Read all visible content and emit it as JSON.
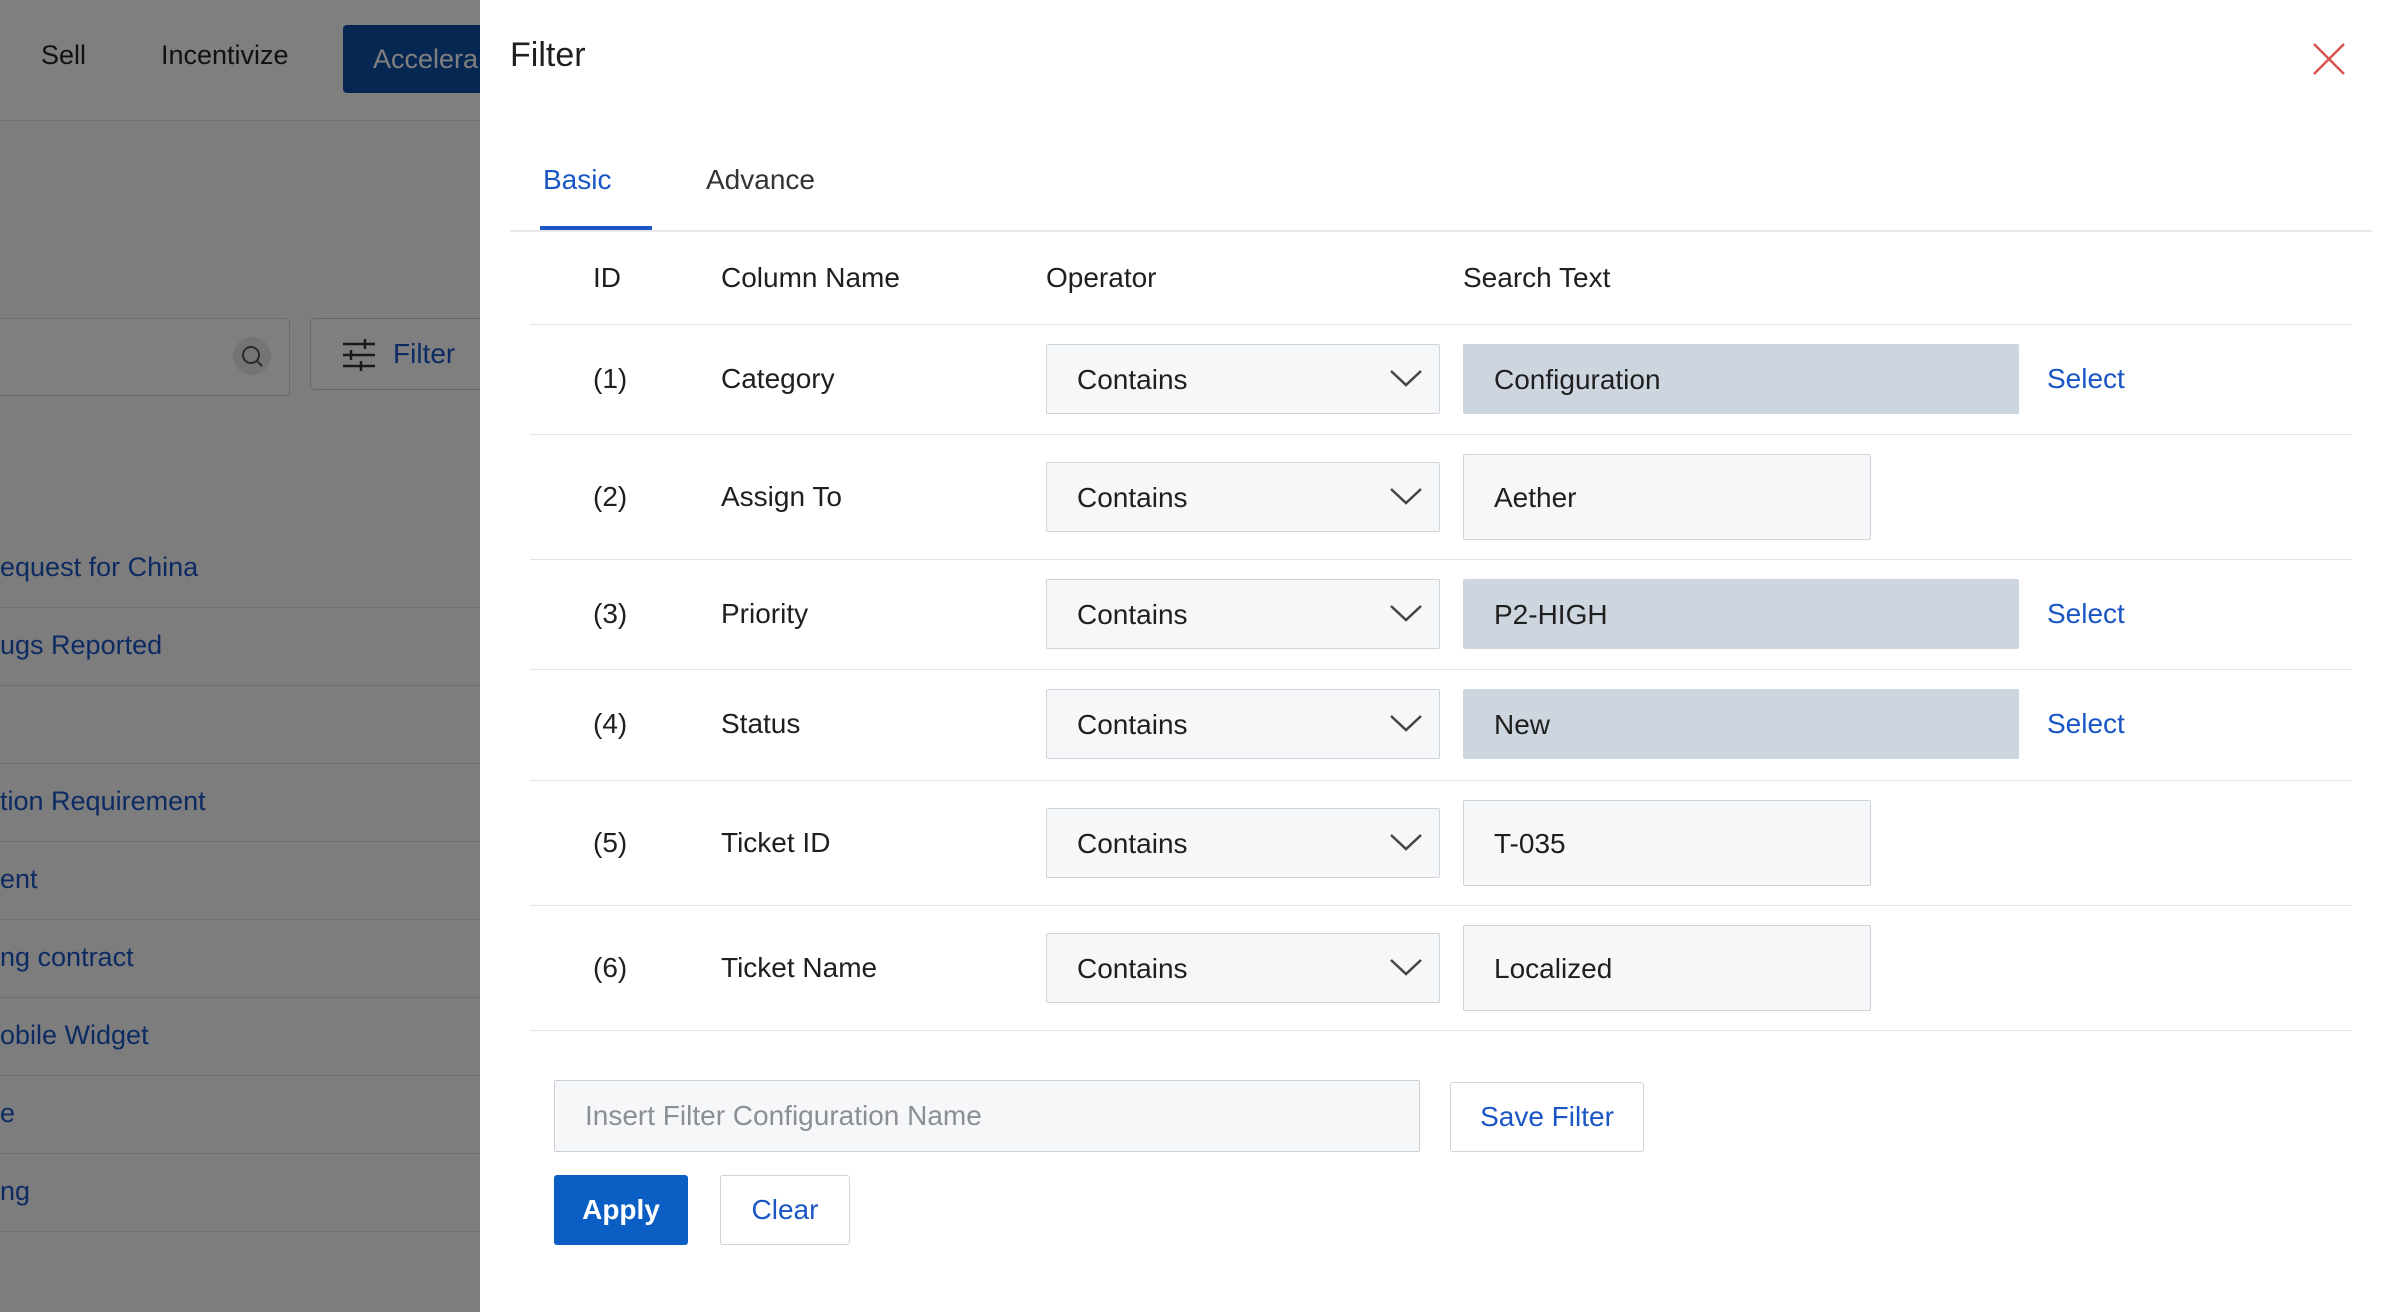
{
  "background": {
    "nav": [
      "Sell",
      "Incentivize"
    ],
    "nav_active": "Accelera",
    "filter_button": "Filter",
    "list_items": [
      "equest for China",
      "ugs Reported",
      "",
      "tion Requirement",
      "ent",
      "ng contract",
      "obile Widget",
      "e",
      "ng"
    ]
  },
  "drawer": {
    "title": "Filter",
    "tabs": [
      "Basic",
      "Advance"
    ],
    "active_tab": "Basic",
    "columns": [
      "ID",
      "Column Name",
      "Operator",
      "Search Text"
    ],
    "rows": [
      {
        "id": "(1)",
        "column": "Category",
        "operator": "Contains",
        "search": "Configuration",
        "select": "Select"
      },
      {
        "id": "(2)",
        "column": "Assign To",
        "operator": "Contains",
        "search": "Aether",
        "select": ""
      },
      {
        "id": "(3)",
        "column": "Priority",
        "operator": "Contains",
        "search": "P2-HIGH",
        "select": "Select"
      },
      {
        "id": "(4)",
        "column": "Status",
        "operator": "Contains",
        "search": "New",
        "select": "Select"
      },
      {
        "id": "(5)",
        "column": "Ticket ID",
        "operator": "Contains",
        "search": "T-035",
        "select": ""
      },
      {
        "id": "(6)",
        "column": "Ticket Name",
        "operator": "Contains",
        "search": "Localized",
        "select": ""
      }
    ],
    "config_name_placeholder": "Insert Filter Configuration Name",
    "save_filter": "Save Filter",
    "apply": "Apply",
    "clear": "Clear"
  },
  "colors": {
    "accent": "#1a56c4",
    "primary_button": "#0b5fc4",
    "filled_field": "#cdd5de",
    "close_icon": "#d9534f"
  }
}
